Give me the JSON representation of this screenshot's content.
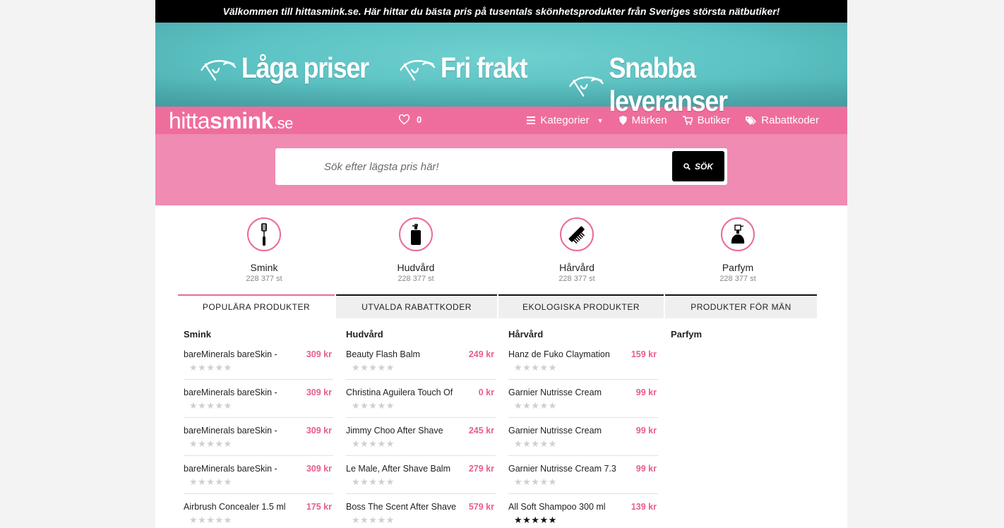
{
  "topbar": {
    "text": "Välkommen till hittasmink.se. Här hittar du bästa pris på tusentals skönhetsprodukter från Sveriges största nätbutiker!"
  },
  "banner": {
    "usps": [
      "Låga priser",
      "Fri frakt",
      "Snabba leveranser"
    ]
  },
  "header": {
    "logo": {
      "part1": "hitta",
      "part2": "smink",
      "part3": ".se"
    },
    "favorites_count": "0",
    "nav": {
      "categories": "Kategorier",
      "brands": "Märken",
      "stores": "Butiker",
      "coupons": "Rabattkoder"
    }
  },
  "search": {
    "placeholder": "Sök efter lägsta pris här!",
    "button": "SÖK"
  },
  "categories": [
    {
      "name": "Smink",
      "count": "228 377 st",
      "icon": "mascara-icon"
    },
    {
      "name": "Hudvård",
      "count": "228 377 st",
      "icon": "pump-bottle-icon"
    },
    {
      "name": "Hårvård",
      "count": "228 377 st",
      "icon": "comb-icon"
    },
    {
      "name": "Parfym",
      "count": "228 377 st",
      "icon": "perfume-icon"
    }
  ],
  "tabs": [
    {
      "label": "POPULÄRA PRODUKTER",
      "active": true
    },
    {
      "label": "UTVALDA RABATTKODER",
      "active": false
    },
    {
      "label": "EKOLOGISKA PRODUKTER",
      "active": false
    },
    {
      "label": "PRODUKTER FÖR MÄN",
      "active": false
    }
  ],
  "columns": [
    {
      "title": "Smink",
      "items": [
        {
          "name": "bareMinerals bareSkin -",
          "price": "309 kr",
          "stars": "★★★★★",
          "rating": 0
        },
        {
          "name": "bareMinerals bareSkin -",
          "price": "309 kr",
          "stars": "★★★★★",
          "rating": 0
        },
        {
          "name": "bareMinerals bareSkin -",
          "price": "309 kr",
          "stars": "★★★★★",
          "rating": 0
        },
        {
          "name": "bareMinerals bareSkin -",
          "price": "309 kr",
          "stars": "★★★★★",
          "rating": 0
        },
        {
          "name": "Airbrush Concealer 1.5 ml",
          "price": "175 kr",
          "stars": "★★★★★",
          "rating": 0
        }
      ]
    },
    {
      "title": "Hudvård",
      "items": [
        {
          "name": "Beauty Flash Balm",
          "price": "249 kr",
          "stars": "★★★★★",
          "rating": 0
        },
        {
          "name": "Christina Aguilera Touch Of",
          "price": "0 kr",
          "stars": "★★★★★",
          "rating": 0
        },
        {
          "name": "Jimmy Choo After Shave",
          "price": "245 kr",
          "stars": "★★★★★",
          "rating": 0
        },
        {
          "name": "Le Male, After Shave Balm",
          "price": "279 kr",
          "stars": "★★★★★",
          "rating": 0
        },
        {
          "name": "Boss The Scent After Shave",
          "price": "579 kr",
          "stars": "★★★★★",
          "rating": 0
        }
      ]
    },
    {
      "title": "Hårvård",
      "items": [
        {
          "name": "Hanz de Fuko Claymation",
          "price": "159 kr",
          "stars": "★★★★★",
          "rating": 0
        },
        {
          "name": "Garnier Nutrisse Cream",
          "price": "99 kr",
          "stars": "★★★★★",
          "rating": 0
        },
        {
          "name": "Garnier Nutrisse Cream",
          "price": "99 kr",
          "stars": "★★★★★",
          "rating": 0
        },
        {
          "name": "Garnier Nutrisse Cream 7.3",
          "price": "99 kr",
          "stars": "★★★★★",
          "rating": 0
        },
        {
          "name": "All Soft Shampoo 300 ml",
          "price": "139 kr",
          "stars": "★★★★★",
          "rating": 5
        }
      ]
    },
    {
      "title": "Parfym",
      "items": []
    }
  ],
  "colors": {
    "pink": "#ef6d9c",
    "pink_light": "#f08bb3",
    "teal": "#5cc2c3",
    "price": "#e85d8f"
  }
}
